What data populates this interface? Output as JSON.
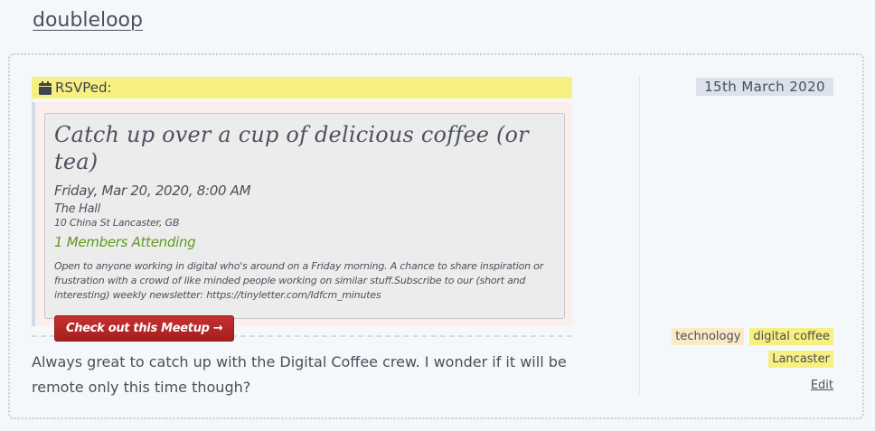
{
  "site": {
    "title": "doubleloop"
  },
  "post": {
    "rsvp_label": "RSVPed:",
    "meetup": {
      "title": "Catch up over a cup of delicious coffee (or tea)",
      "datetime": "Friday, Mar 20, 2020, 8:00 AM",
      "venue": "The Hall",
      "address": "10 China St Lancaster, GB",
      "attending": "1 Members Attending",
      "description": "Open to anyone working in digital who's around on a Friday morning. A chance to share inspiration or frustration with a crowd of like minded people working on similar stuff.Subscribe to our (short and interesting) weekly newsletter: https://tinyletter.com/ldfcm_minutes",
      "button_label": "Check out this Meetup →"
    },
    "body": "Always great to catch up with the Digital Coffee crew.  I wonder if it will be remote only this time though?",
    "date": "15th March 2020",
    "tags": [
      "technology",
      "digital coffee",
      "Lancaster"
    ],
    "edit_label": "Edit"
  },
  "icons": {
    "rsvp": "calendar-icon"
  },
  "colors": {
    "highlight": "#f7ef7f",
    "button": "#b52424",
    "attending": "#5f9a1f"
  }
}
